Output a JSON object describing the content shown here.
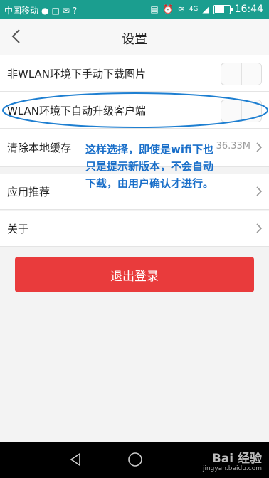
{
  "statusbar": {
    "carrier": "中国移动",
    "network": "4G",
    "time": "16:44",
    "battery_level": 0.7
  },
  "header": {
    "title": "设置",
    "back_icon": "chevron-left-icon"
  },
  "rows": [
    {
      "label": "非WLAN环境下手动下载图片",
      "type": "toggle"
    },
    {
      "label": "WLAN环境下自动升级客户端",
      "type": "toggle"
    },
    {
      "label": "清除本地缓存",
      "value": "36.33M",
      "type": "chevron"
    },
    {
      "label": "应用推荐",
      "type": "chevron"
    },
    {
      "label": "关于",
      "type": "chevron"
    }
  ],
  "annotation": {
    "text": "这样选择，即使是wifi下也只是提示新版本，不会自动下载，由用户确认才进行。",
    "color": "#1a6fc9"
  },
  "logout_button": {
    "label": "退出登录",
    "color": "#e93b3c"
  },
  "watermark": {
    "brand": "Bai 经验",
    "url": "jingyan.baidu.com"
  },
  "colors": {
    "statusbar": "#1b9e8f",
    "highlight_oval": "#1e7fd1"
  }
}
